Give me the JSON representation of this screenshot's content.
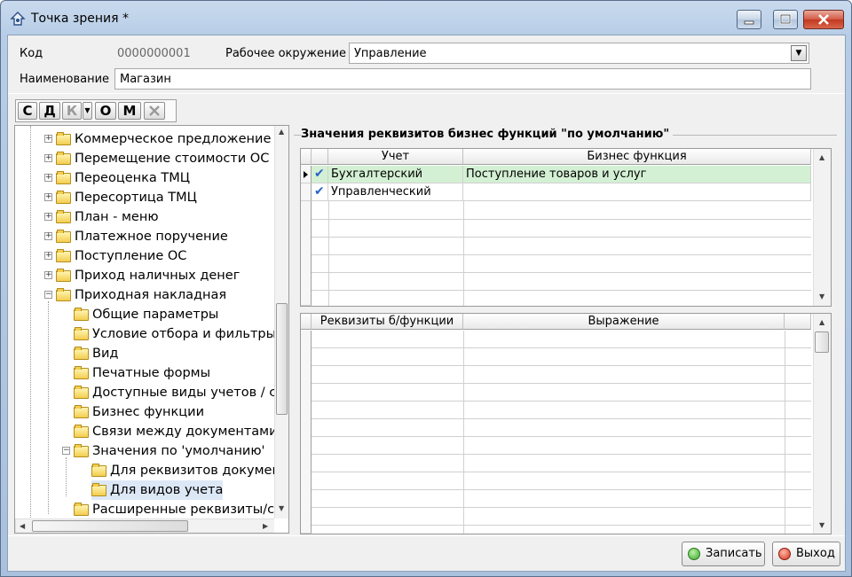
{
  "window": {
    "title": "Точка зрения *",
    "controls": {
      "minimize": "minimize",
      "maximize": "maximize",
      "close": "close"
    }
  },
  "header": {
    "code_label": "Код",
    "code_value": "0000000001",
    "env_label": "Рабочее окружение",
    "env_value": "Управление",
    "name_label": "Наименование",
    "name_value": "Магазин"
  },
  "toolbar": {
    "buttons": [
      "С",
      "Д",
      "К",
      "О",
      "М"
    ]
  },
  "tree": {
    "items": [
      "Коммерческое предложение",
      "Перемещение стоимости ОС",
      "Переоценка ТМЦ",
      "Пересортица ТМЦ",
      "План - меню",
      "Платежное поручение",
      "Поступление ОС",
      "Приход наличных денег",
      "Приходная накладная",
      "Общие параметры",
      "Условие отбора и фильтры",
      "Вид",
      "Печатные формы",
      "Доступные виды учетов / ста",
      "Бизнес функции",
      "Связи между документами",
      "Значения по 'умолчанию'",
      "Для реквизитов документ",
      "Для видов учета",
      "Расширенные реквизиты/сво"
    ]
  },
  "panel": {
    "title": "Значения реквизитов бизнес функций \"по умолчанию\"",
    "top_grid": {
      "headers": [
        "Учет",
        "Бизнес функция"
      ],
      "rows": [
        {
          "account": "Бухгалтерский",
          "function": "Поступление товаров и услуг",
          "checked": true,
          "current": true
        },
        {
          "account": "Управленческий",
          "function": "",
          "checked": true,
          "current": false
        }
      ]
    },
    "bottom_grid": {
      "headers": [
        "Реквизиты б/функции",
        "Выражение"
      ]
    }
  },
  "footer": {
    "save_label": "Записать",
    "exit_label": "Выход"
  },
  "colors": {
    "selected_row": "#d4f0d4",
    "check": "#2a62c9",
    "title_bar": "#b7cde6"
  }
}
